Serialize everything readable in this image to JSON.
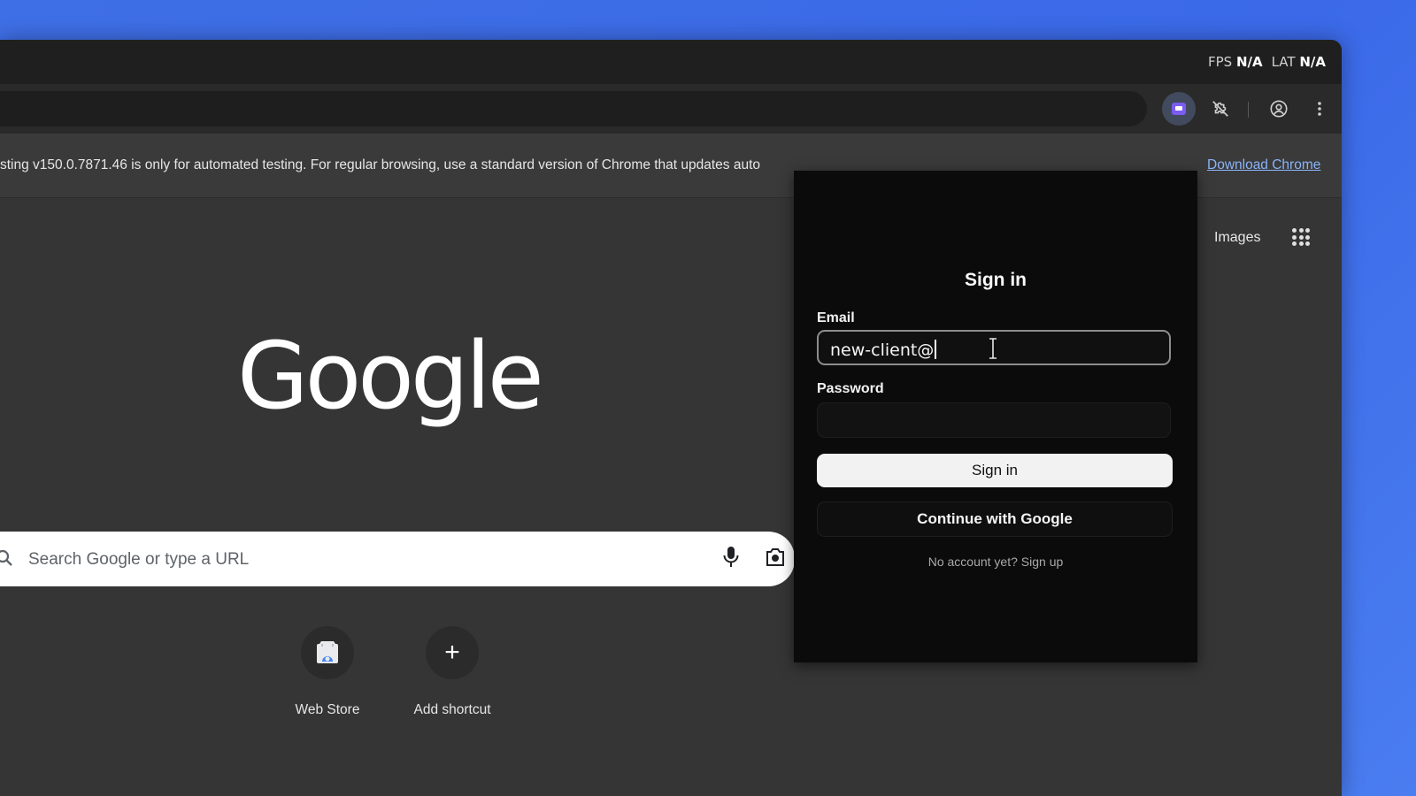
{
  "titlebar": {
    "fps_label": "FPS",
    "fps_value": "N/A",
    "lat_label": "LAT",
    "lat_value": "N/A"
  },
  "infobar": {
    "message": "sting v150.0.7871.46 is only for automated testing. For regular browsing, use a standard version of Chrome that updates auto",
    "download_link": "Download Chrome"
  },
  "ntp": {
    "logo_text": "Google",
    "images_link": "Images",
    "search_placeholder": "Search Google or type a URL",
    "shortcuts": [
      {
        "label": "Web Store"
      },
      {
        "label": "Add shortcut"
      }
    ]
  },
  "signin_popup": {
    "title": "Sign in",
    "email_label": "Email",
    "email_value": "new-client@",
    "password_label": "Password",
    "password_value": "",
    "signin_button": "Sign in",
    "google_button": "Continue with Google",
    "signup_text": "No account yet? Sign up"
  },
  "colors": {
    "desktop_bg": "#3f6fe6",
    "window_bg": "#353535",
    "popup_bg": "#0b0b0b",
    "link": "#8ab4f8",
    "extension_accent": "#7a5cf0"
  },
  "icons": [
    "extension-icon",
    "puzzle-off-icon",
    "profile-icon",
    "more-vert-icon",
    "apps-grid-icon",
    "search-icon",
    "mic-icon",
    "camera-icon",
    "webstore-icon",
    "plus-icon",
    "text-cursor-icon"
  ]
}
